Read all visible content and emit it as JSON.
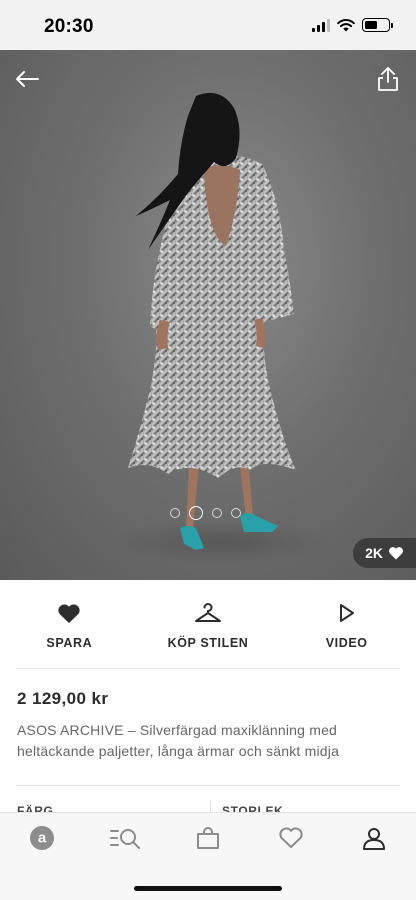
{
  "status_bar": {
    "time": "20:30",
    "battery_level": 0.55
  },
  "gallery": {
    "image_count": 4,
    "active_index": 1,
    "likes": "2K",
    "colors": {
      "background": "#6f6f6f",
      "dress": "#b9b9b9",
      "hair": "#151515",
      "shoes": "#2aa1a8"
    }
  },
  "actions": {
    "save_label": "SPARA",
    "shop_look_label": "KÖP STILEN",
    "video_label": "VIDEO"
  },
  "product": {
    "price": "2 129,00 kr",
    "title": "ASOS ARCHIVE – Silverfärgad maxiklänning med heltäckande paljetter, långa ärmar och sänkt midja"
  },
  "selectors": {
    "color_label": "FÄRG",
    "size_label": "STORLEK"
  },
  "bottom_nav": {
    "items": [
      "home-icon",
      "search-icon",
      "bag-icon",
      "saved-icon",
      "account-icon"
    ],
    "active_color": "#2d2d2d",
    "inactive_color": "#8c8c8c"
  }
}
